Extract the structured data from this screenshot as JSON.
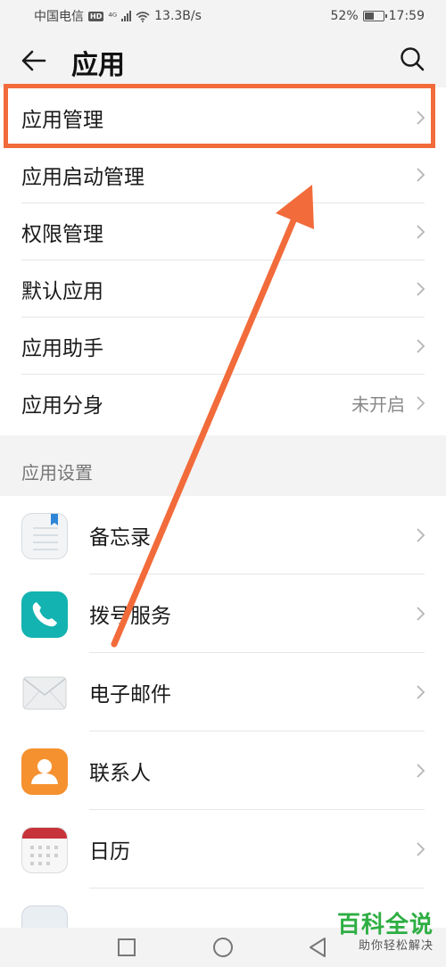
{
  "status_bar": {
    "carrier": "中国电信",
    "network_badge": "HD",
    "network_type": "⁴ᴳ",
    "speed": "13.3B/s",
    "battery": "52%",
    "time": "17:59"
  },
  "header": {
    "title": "应用",
    "back_icon": "arrow-left-icon",
    "search_icon": "search-icon"
  },
  "menu": {
    "items": [
      {
        "label": "应用管理",
        "value": ""
      },
      {
        "label": "应用启动管理",
        "value": ""
      },
      {
        "label": "权限管理",
        "value": ""
      },
      {
        "label": "默认应用",
        "value": ""
      },
      {
        "label": "应用助手",
        "value": ""
      },
      {
        "label": "应用分身",
        "value": "未开启"
      }
    ]
  },
  "app_settings": {
    "section_title": "应用设置",
    "apps": [
      {
        "label": "备忘录",
        "icon": "notes-icon"
      },
      {
        "label": "拨号服务",
        "icon": "phone-icon"
      },
      {
        "label": "电子邮件",
        "icon": "mail-icon"
      },
      {
        "label": "联系人",
        "icon": "contacts-icon"
      },
      {
        "label": "日历",
        "icon": "calendar-icon"
      }
    ]
  },
  "nav_bar": {
    "recent_icon": "square-icon",
    "home_icon": "circle-icon",
    "back_icon": "triangle-back-icon"
  },
  "annotation": {
    "color": "#f26b3a"
  },
  "watermark": {
    "title": "百科全说",
    "subtitle": "助你轻松解决",
    "color": "#2eae43"
  }
}
